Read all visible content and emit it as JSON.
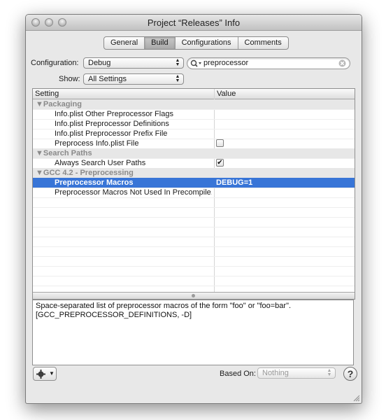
{
  "window": {
    "title": "Project “Releases” Info"
  },
  "tabs": [
    {
      "label": "General"
    },
    {
      "label": "Build"
    },
    {
      "label": "Configurations"
    },
    {
      "label": "Comments"
    }
  ],
  "toolbar": {
    "configuration_label": "Configuration:",
    "configuration_value": "Debug",
    "show_label": "Show:",
    "show_value": "All Settings",
    "search_value": "preprocessor"
  },
  "table": {
    "headers": {
      "setting": "Setting",
      "value": "Value"
    },
    "rows": [
      {
        "label": "▼Packaging"
      },
      {
        "label": "Info.plist Other Preprocessor Flags",
        "value": ""
      },
      {
        "label": "Info.plist Preprocessor Definitions",
        "value": ""
      },
      {
        "label": "Info.plist Preprocessor Prefix File",
        "value": ""
      },
      {
        "label": "Preprocess Info.plist File",
        "checked": false
      },
      {
        "label": "▼Search Paths"
      },
      {
        "label": "Always Search User Paths",
        "checked": true
      },
      {
        "label": "▼GCC 4.2 - Preprocessing"
      },
      {
        "label": "Preprocessor Macros",
        "value": "DEBUG=1"
      },
      {
        "label": "Preprocessor Macros Not Used In Precompile...",
        "value": ""
      }
    ]
  },
  "description": {
    "line1": "Space-separated list of preprocessor macros of the form \"foo\" or \"foo=bar\".",
    "line2": "[GCC_PREPROCESSOR_DEFINITIONS, -D]"
  },
  "footer": {
    "based_on_label": "Based On:",
    "based_on_value": "Nothing",
    "help_label": "?"
  },
  "icons": {
    "gear": "gear-icon",
    "search": "search-icon",
    "clear": "clear-search-icon",
    "help": "help-icon"
  },
  "colors": {
    "selection": "#3875d7",
    "group_row": "#e7e7e7"
  }
}
